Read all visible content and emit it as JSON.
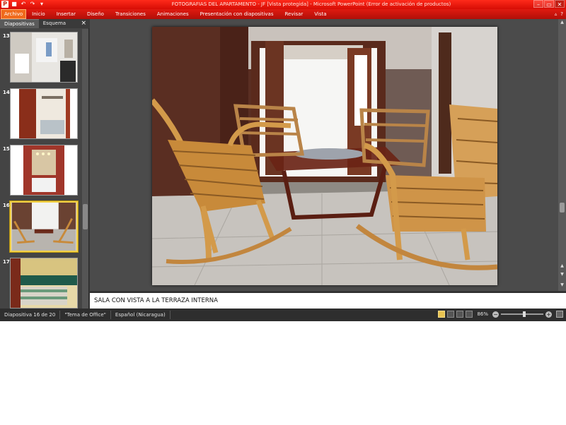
{
  "window": {
    "title": "FOTOGRAFIAS DEL APARTAMENTO - JF [Vista protegida] - Microsoft PowerPoint (Error de activación de productos)",
    "app_icon": "P",
    "minimize_glyph": "–",
    "maximize_glyph": "▭",
    "close_glyph": "✕"
  },
  "quick_access": [
    {
      "name": "save-icon",
      "glyph": "■"
    },
    {
      "name": "undo-icon",
      "glyph": "↶"
    },
    {
      "name": "redo-icon",
      "glyph": "↷"
    },
    {
      "name": "customize-qat-icon",
      "glyph": "▾"
    }
  ],
  "ribbon": {
    "tabs": [
      "Archivo",
      "Inicio",
      "Insertar",
      "Diseño",
      "Transiciones",
      "Animaciones",
      "Presentación con diapositivas",
      "Revisar",
      "Vista"
    ],
    "active_tab": "Archivo",
    "minimize_ribbon_glyph": "▵",
    "help_glyph": "?"
  },
  "slides_panel": {
    "tabs": [
      "Diapositivas",
      "Esquema"
    ],
    "active_tab": "Diapositivas",
    "close_glyph": "×",
    "thumbnails": [
      {
        "number": "13",
        "selected": false
      },
      {
        "number": "14",
        "selected": false
      },
      {
        "number": "15",
        "selected": false
      },
      {
        "number": "16",
        "selected": true
      },
      {
        "number": "17",
        "selected": false
      }
    ]
  },
  "notes": {
    "text": "SALA CON VISTA A LA TERRAZA INTERNA"
  },
  "status": {
    "slide_info": "Diapositiva 16 de 20",
    "theme": "\"Tema de Office\"",
    "language": "Español (Nicaragua)",
    "zoom": "86%",
    "zoom_fraction": 0.55,
    "zoom_out_glyph": "−",
    "zoom_in_glyph": "+"
  },
  "colors": {
    "title_bar": "#e0180e",
    "ribbon": "#c7140b",
    "file_tab": "#f06a1c",
    "selection": "#f2d14a"
  }
}
